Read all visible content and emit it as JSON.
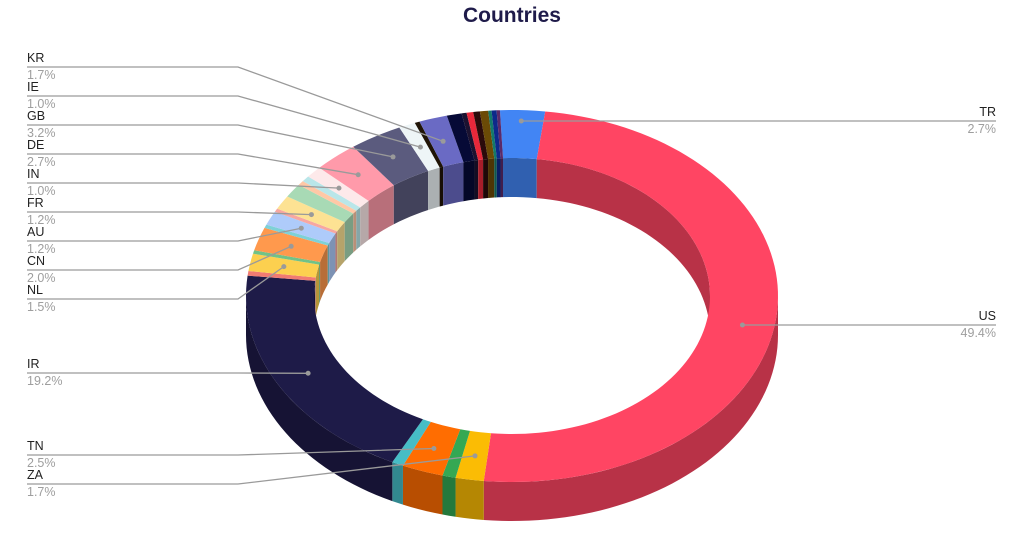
{
  "chart_data": {
    "type": "pie",
    "subtype": "3d-donut",
    "title": "Countries",
    "start": "top",
    "direction": "clockwise",
    "slices": [
      {
        "label": "TR",
        "value": 2.7,
        "color": "#4285f4",
        "labeled": true,
        "side": "right"
      },
      {
        "label": "US",
        "value": 49.4,
        "color": "#ff4563",
        "labeled": true,
        "side": "right"
      },
      {
        "label": "ZA",
        "value": 1.7,
        "color": "#fbbc04",
        "labeled": true,
        "side": "left"
      },
      {
        "label": "",
        "value": 0.8,
        "color": "#34a853",
        "labeled": false
      },
      {
        "label": "TN",
        "value": 2.5,
        "color": "#ff6d01",
        "labeled": true,
        "side": "left"
      },
      {
        "label": "",
        "value": 0.7,
        "color": "#46bdc6",
        "labeled": false
      },
      {
        "label": "IR",
        "value": 19.2,
        "color": "#1e1b48",
        "labeled": true,
        "side": "left"
      },
      {
        "label": "",
        "value": 0.4,
        "color": "#f07b72",
        "labeled": false
      },
      {
        "label": "NL",
        "value": 1.5,
        "color": "#fcd04f",
        "labeled": true,
        "side": "left"
      },
      {
        "label": "",
        "value": 0.3,
        "color": "#71c287",
        "labeled": false
      },
      {
        "label": "CN",
        "value": 2.0,
        "color": "#ff994d",
        "labeled": true,
        "side": "left"
      },
      {
        "label": "",
        "value": 0.3,
        "color": "#7ed1d7",
        "labeled": false
      },
      {
        "label": "AU",
        "value": 1.2,
        "color": "#aecbfa",
        "labeled": true,
        "side": "left"
      },
      {
        "label": "",
        "value": 0.3,
        "color": "#f7a7a1",
        "labeled": false
      },
      {
        "label": "FR",
        "value": 1.2,
        "color": "#fde293",
        "labeled": true,
        "side": "left"
      },
      {
        "label": "",
        "value": 1.2,
        "color": "#a8dab5",
        "labeled": false
      },
      {
        "label": "",
        "value": 0.4,
        "color": "#ffc8a6",
        "labeled": false
      },
      {
        "label": "",
        "value": 0.5,
        "color": "#b9e6e9",
        "labeled": false
      },
      {
        "label": "IN",
        "value": 1.0,
        "color": "#fde9ea",
        "labeled": true,
        "side": "left"
      },
      {
        "label": "DE",
        "value": 2.7,
        "color": "#ff9aaa",
        "labeled": true,
        "side": "left"
      },
      {
        "label": "GB",
        "value": 3.2,
        "color": "#5b5b7e",
        "labeled": true,
        "side": "left"
      },
      {
        "label": "IE",
        "value": 1.0,
        "color": "#eef5f7",
        "labeled": true,
        "side": "left"
      },
      {
        "label": "",
        "value": 0.3,
        "color": "#201406",
        "labeled": false
      },
      {
        "label": "KR",
        "value": 1.7,
        "color": "#6a6ac4",
        "labeled": true,
        "side": "left"
      },
      {
        "label": "",
        "value": 0.9,
        "color": "#060a36",
        "labeled": false
      },
      {
        "label": "",
        "value": 0.3,
        "color": "#1b1230",
        "labeled": false
      },
      {
        "label": "",
        "value": 0.4,
        "color": "#e8283a",
        "labeled": false
      },
      {
        "label": "",
        "value": 0.4,
        "color": "#2b0b0b",
        "labeled": false
      },
      {
        "label": "",
        "value": 0.5,
        "color": "#6b4a06",
        "labeled": false
      },
      {
        "label": "",
        "value": 0.2,
        "color": "#137a6a",
        "labeled": false
      },
      {
        "label": "",
        "value": 0.3,
        "color": "#0d2a8a",
        "labeled": false
      },
      {
        "label": "",
        "value": 0.2,
        "color": "#5a2a6a",
        "labeled": false
      }
    ],
    "labels": [
      {
        "name": "KR",
        "pct": "1.7%"
      },
      {
        "name": "IE",
        "pct": "1.0%"
      },
      {
        "name": "GB",
        "pct": "3.2%"
      },
      {
        "name": "DE",
        "pct": "2.7%"
      },
      {
        "name": "IN",
        "pct": "1.0%"
      },
      {
        "name": "FR",
        "pct": "1.2%"
      },
      {
        "name": "AU",
        "pct": "1.2%"
      },
      {
        "name": "CN",
        "pct": "2.0%"
      },
      {
        "name": "NL",
        "pct": "1.5%"
      },
      {
        "name": "IR",
        "pct": "19.2%"
      },
      {
        "name": "TN",
        "pct": "2.5%"
      },
      {
        "name": "ZA",
        "pct": "1.7%"
      },
      {
        "name": "TR",
        "pct": "2.7%"
      },
      {
        "name": "US",
        "pct": "49.4%"
      }
    ],
    "legend": "none"
  }
}
